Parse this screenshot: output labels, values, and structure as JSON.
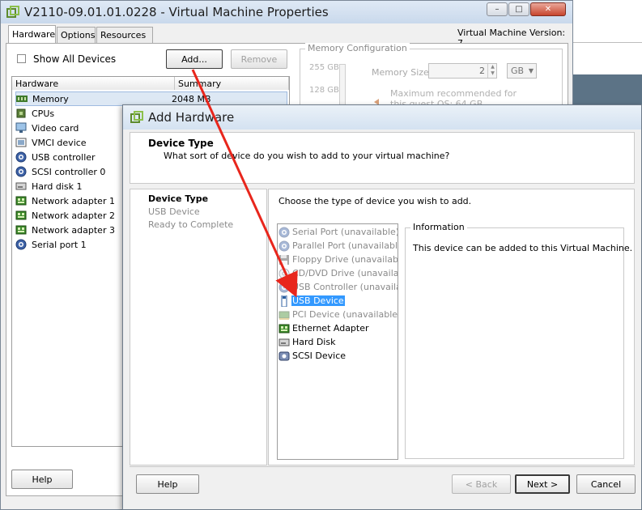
{
  "vm_window": {
    "title": "V2110-09.01.01.0228 - Virtual Machine Properties",
    "tabs": [
      "Hardware",
      "Options",
      "Resources"
    ],
    "version_label": "Virtual Machine Version: 7",
    "show_all_devices_label": "Show All Devices",
    "add_button": "Add...",
    "remove_button": "Remove",
    "list_headers": [
      "Hardware",
      "Summary"
    ],
    "devices": [
      {
        "name": "Memory",
        "summary": "2048 MB",
        "icon": "memory-icon"
      },
      {
        "name": "CPUs",
        "summary": "",
        "icon": "cpu-icon"
      },
      {
        "name": "Video card",
        "summary": "",
        "icon": "monitor-icon"
      },
      {
        "name": "VMCI device",
        "summary": "",
        "icon": "vmci-icon"
      },
      {
        "name": "USB controller",
        "summary": "",
        "icon": "usb-icon"
      },
      {
        "name": "SCSI controller 0",
        "summary": "",
        "icon": "scsi-icon"
      },
      {
        "name": "Hard disk 1",
        "summary": "",
        "icon": "disk-icon"
      },
      {
        "name": "Network adapter 1",
        "summary": "",
        "icon": "network-icon"
      },
      {
        "name": "Network adapter 2",
        "summary": "",
        "icon": "network-icon"
      },
      {
        "name": "Network adapter 3",
        "summary": "",
        "icon": "network-icon"
      },
      {
        "name": "Serial port 1",
        "summary": "",
        "icon": "serial-icon"
      }
    ],
    "memory_config": {
      "group_label": "Memory Configuration",
      "scale_labels": [
        "255 GB",
        "128 GB"
      ],
      "memory_size_label": "Memory Size:",
      "memory_size_value": "2",
      "unit": "GB",
      "recommendation": "Maximum recommended for this guest OS: 64 GB."
    },
    "help_button": "Help"
  },
  "dialog": {
    "title": "Add Hardware",
    "header_title": "Device Type",
    "header_subtitle": "What sort of device do you wish to add to your virtual machine?",
    "steps": [
      {
        "label": "Device Type",
        "current": true
      },
      {
        "label": "USB Device",
        "current": false
      },
      {
        "label": "Ready to Complete",
        "current": false
      }
    ],
    "prompt": "Choose the type of device you wish to add.",
    "device_types": [
      {
        "label": "Serial Port (unavailable)",
        "available": false,
        "icon": "serial-port-icon"
      },
      {
        "label": "Parallel Port (unavailable)",
        "available": false,
        "icon": "parallel-port-icon"
      },
      {
        "label": "Floppy Drive (unavailable)",
        "available": false,
        "icon": "floppy-icon"
      },
      {
        "label": "CD/DVD Drive (unavailable)",
        "available": false,
        "icon": "cd-dvd-icon"
      },
      {
        "label": "USB Controller (unavailable)",
        "available": false,
        "icon": "usb-controller-icon"
      },
      {
        "label": "USB Device",
        "available": true,
        "selected": true,
        "icon": "usb-device-icon"
      },
      {
        "label": "PCI Device (unavailable)",
        "available": false,
        "icon": "pci-icon"
      },
      {
        "label": "Ethernet Adapter",
        "available": true,
        "icon": "ethernet-icon"
      },
      {
        "label": "Hard Disk",
        "available": true,
        "icon": "hard-disk-icon"
      },
      {
        "label": "SCSI Device",
        "available": true,
        "icon": "scsi-device-icon"
      }
    ],
    "info_label": "Information",
    "info_text": "This device can be added to this Virtual Machine.",
    "help_button": "Help",
    "back_button": "< Back",
    "next_button": "Next >",
    "cancel_button": "Cancel"
  },
  "colors": {
    "selection": "#3399ff",
    "arrow": "#e8261c",
    "window_bg": "#f0f0f0"
  }
}
